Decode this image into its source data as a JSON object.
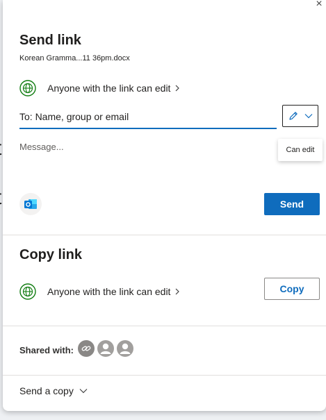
{
  "background": {
    "fragment_1": "t",
    "fragment_2": "t"
  },
  "send_link": {
    "title": "Send link",
    "filename": "Korean Gramma...11 36pm.docx",
    "permission": "Anyone with the link can edit",
    "to_placeholder": "To: Name, group or email",
    "permission_tooltip": "Can edit",
    "message_placeholder": "Message...",
    "send_label": "Send"
  },
  "copy_link": {
    "title": "Copy link",
    "permission": "Anyone with the link can edit",
    "copy_label": "Copy"
  },
  "shared_with": {
    "label": "Shared with:"
  },
  "send_copy": {
    "label": "Send a copy"
  },
  "colors": {
    "accent": "#0f6cbd",
    "globe": "#107c10",
    "outlook": "#0078d4"
  }
}
